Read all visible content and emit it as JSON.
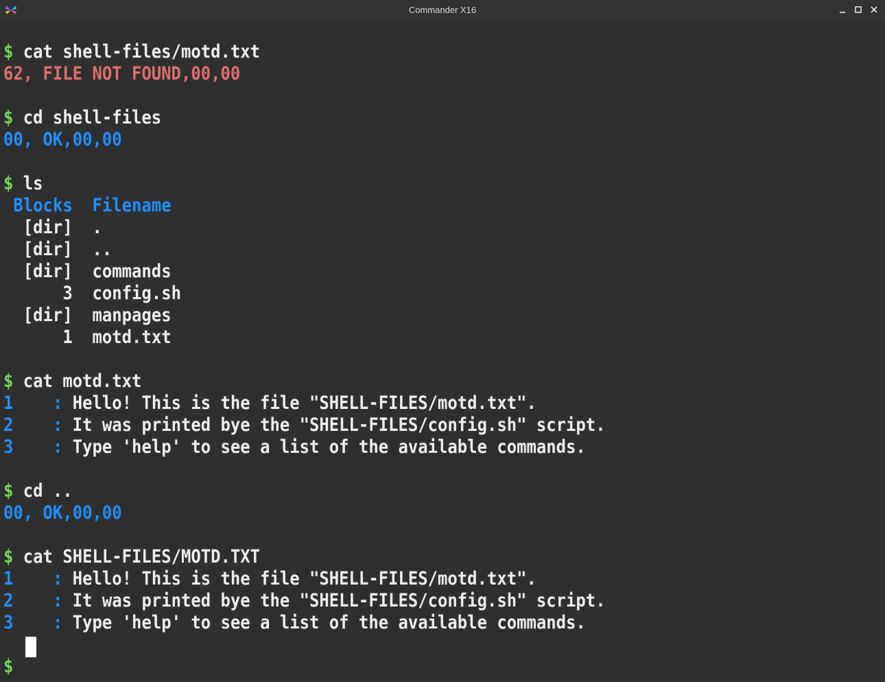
{
  "window": {
    "title": "Commander X16"
  },
  "terminal": {
    "prompt": "$ ",
    "blocks": {
      "cmd1": "cat shell-files/motd.txt",
      "err1": "62, FILE NOT FOUND,00,00",
      "cmd2": "cd shell-files",
      "ok1": "00, OK,00,00",
      "cmd3": "ls",
      "ls_header_blocks": "Blocks",
      "ls_header_filename": "Filename",
      "ls_rows": [
        {
          "blocks": "[dir]",
          "name": "."
        },
        {
          "blocks": "[dir]",
          "name": ".."
        },
        {
          "blocks": "[dir]",
          "name": "commands"
        },
        {
          "blocks": "3",
          "name": "config.sh"
        },
        {
          "blocks": "[dir]",
          "name": "manpages"
        },
        {
          "blocks": "1",
          "name": "motd.txt"
        }
      ],
      "cmd4": "cat motd.txt",
      "motd": [
        {
          "num": "1",
          "sep": ":",
          "text": "Hello! This is the file \"SHELL-FILES/motd.txt\"."
        },
        {
          "num": "2",
          "sep": ":",
          "text": "It was printed bye the \"SHELL-FILES/config.sh\" script."
        },
        {
          "num": "3",
          "sep": ":",
          "text": "Type 'help' to see a list of the available commands."
        }
      ],
      "cmd5": "cd ..",
      "ok2": "00, OK,00,00",
      "cmd6": "cat SHELL-FILES/MOTD.TXT",
      "motd2": [
        {
          "num": "1",
          "sep": ":",
          "text": "Hello! This is the file \"SHELL-FILES/motd.txt\"."
        },
        {
          "num": "2",
          "sep": ":",
          "text": "It was printed bye the \"SHELL-FILES/config.sh\" script."
        },
        {
          "num": "3",
          "sep": ":",
          "text": "Type 'help' to see a list of the available commands."
        }
      ]
    },
    "colors": {
      "background": "#2f2f2f",
      "text": "#eeeeee",
      "prompt": "#77d356",
      "error": "#e06f6f",
      "status_ok": "#1e90ff"
    }
  },
  "icons": {
    "app": "x16-butterfly-icon",
    "minimize": "minimize-icon",
    "maximize": "maximize-icon",
    "close": "close-icon"
  }
}
